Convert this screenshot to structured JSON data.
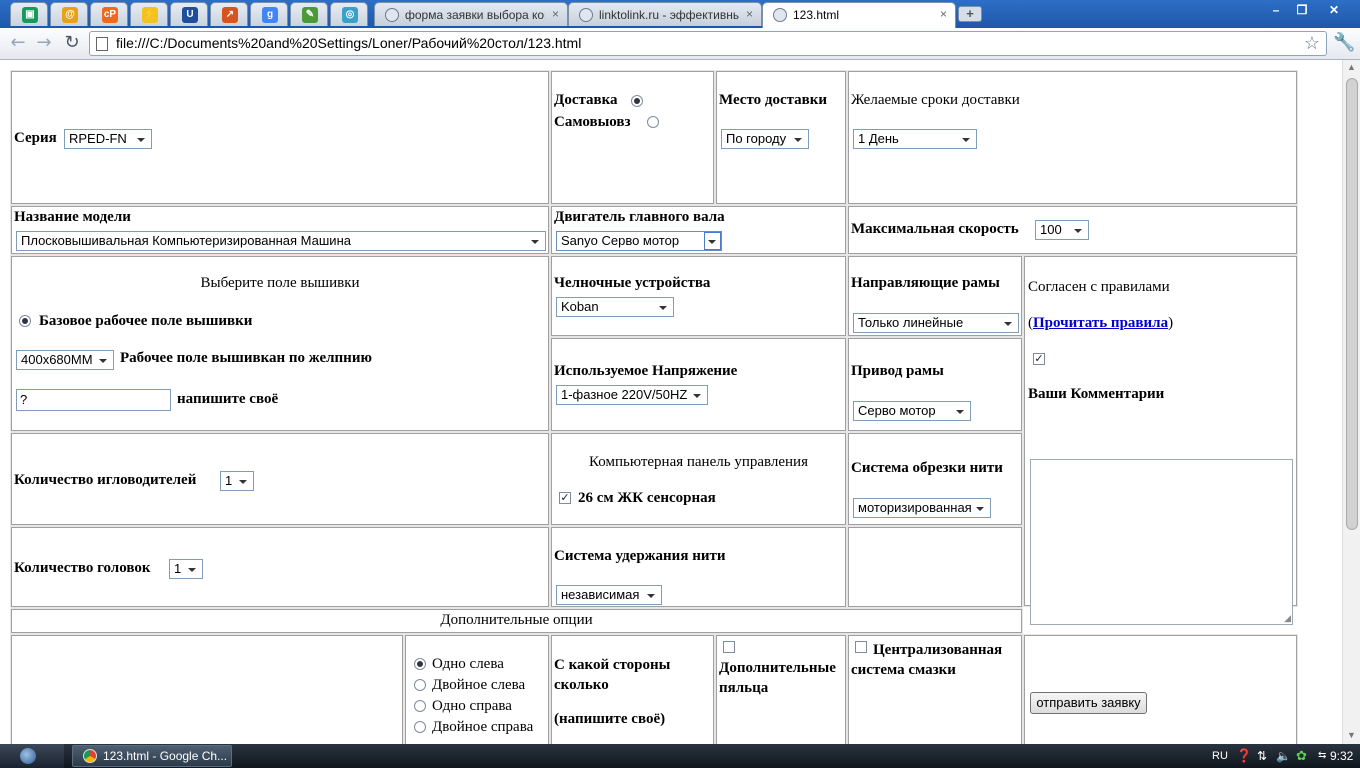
{
  "browser": {
    "tabs": [
      {
        "title": "форма заявки выбора компл"
      },
      {
        "title": "linktolink.ru - эффективный о"
      },
      {
        "title": "123.html"
      }
    ],
    "pinned_icons": [
      "site-icon-green",
      "at-icon",
      "cp-icon",
      "lightning-icon",
      "u-icon",
      "chart-icon",
      "google-icon",
      "leaf-icon",
      "orbit-icon"
    ],
    "url": "file:///C:/Documents%20and%20Settings/Loner/Рабочий%20стол/123.html",
    "new_tab_glyph": "+",
    "close_glyph": "×"
  },
  "form": {
    "series_label": "Серия",
    "series_value": "RPED-FN",
    "delivery_label": "Доставка",
    "pickup_label": "Самовыовз",
    "place_label": "Место доставки",
    "place_value": "По городу",
    "terms_label": "Желаемые сроки доставки",
    "terms_value": "1 День",
    "model_label": "Название модели",
    "model_value": "Плосковышивальная Компьютеризированная Машина",
    "motor_label": "Двигатель главного вала",
    "motor_value": "Sanyo Серво мотор",
    "speed_label": "Максимальная скорость",
    "speed_value": "100",
    "field_title": "Выберите поле вышивки",
    "field_base_label": "Базовое рабочее поле вышивки",
    "field_size_value": "400x680MM",
    "field_custom_label": "Рабочее поле вышивкан по желпнию",
    "field_input_value": "?",
    "field_write_label": "напишите своё",
    "shuttle_label": "Челночные устройства",
    "shuttle_value": "Koban",
    "rails_label": "Направляющие рамы",
    "rails_value": "Только линейные",
    "agree_label": "Согласен с правилами",
    "rules_open": "(",
    "rules_link": "Прочитать правила",
    "rules_close": ")",
    "comments_label": "Ваши Комментарии",
    "voltage_label": "Используемое Напряжение",
    "voltage_value": "1-фазное 220V/50HZ",
    "frame_drive_label": "Привод рамы",
    "frame_drive_value": "Серво мотор",
    "needles_label": "Количество игловодителей",
    "needles_value": "1",
    "panel_title": "Компьютерная панель управления",
    "panel_option": "26 см ЖК сенсорная",
    "trim_label": "Система обрезки нити",
    "trim_value": "моторизированная",
    "heads_label": "Количество головок",
    "heads_value": "1",
    "hold_label": "Система удержания нити",
    "hold_value": "независимая",
    "extra_title": "Дополнительные опции",
    "side_options": [
      "Одно слева",
      "Двойное слева",
      "Одно справа",
      "Двойное справа"
    ],
    "side_question": "С какой стороны сколько",
    "side_write": "(напишите своё)",
    "extra_hoops": "Дополнительные пяльца",
    "lube_label": "Централизованная система смазки",
    "submit_label": "отправить заявку"
  },
  "taskbar": {
    "task_title": "123.html - Google Ch...",
    "lang": "RU",
    "time": "9:32"
  }
}
